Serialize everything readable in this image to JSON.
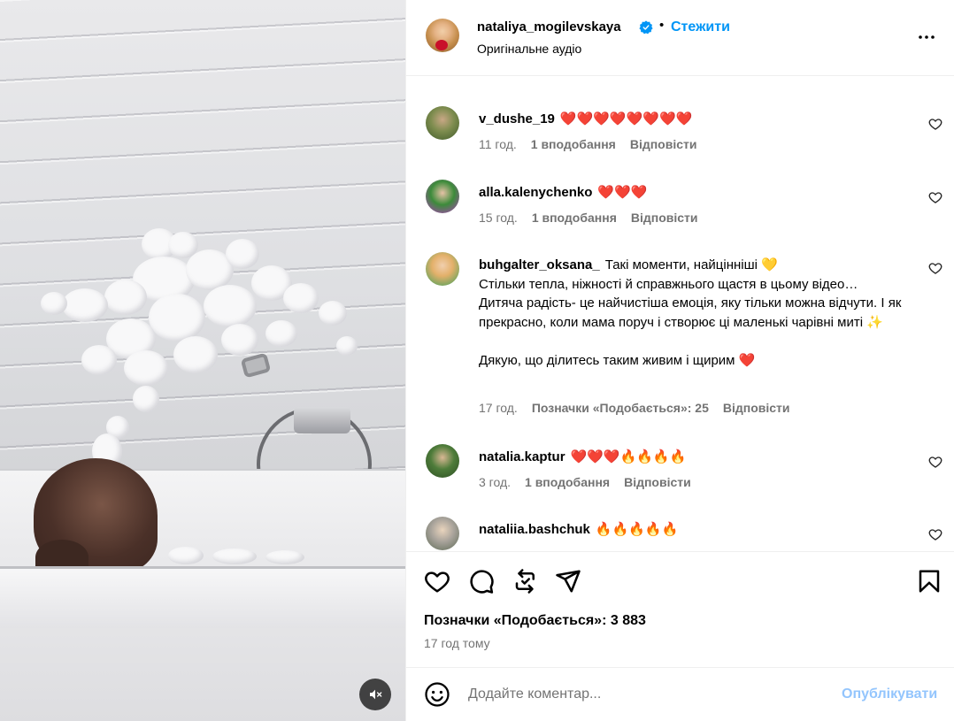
{
  "header": {
    "username": "nataliya_mogilevskaya",
    "separator": "•",
    "follow_label": "Стежити",
    "subtitle": "Оригінальне аудіо",
    "verified_icon": "verified-badge-icon",
    "more_icon": "more-horizontal-icon"
  },
  "comments": [
    {
      "user": "v_dushe_19",
      "text": "❤️❤️❤️❤️❤️❤️❤️❤️",
      "time": "11 год.",
      "likes": "1 вподобання",
      "reply": "Відповісти"
    },
    {
      "user": "alla.kalenychenko",
      "text": "❤️❤️❤️",
      "time": "15 год.",
      "likes": "1 вподобання",
      "reply": "Відповісти"
    },
    {
      "user": "buhgalter_oksana_",
      "text": "Такі моменти, найцінніші 💛",
      "text2": "Стільки тепла, ніжності й справжнього щастя в цьому відео… Дитяча радість- це найчистіша емоція, яку тільки можна відчути. І як прекрасно, коли мама поруч і створює ці маленькі чарівні миті ✨",
      "text3": "Дякую, що ділитесь таким живим і щирим ❤️",
      "time": "17 год.",
      "likes": "Позначки «Подобається»: 25",
      "reply": "Відповісти"
    },
    {
      "user": "natalia.kaptur",
      "text": "❤️❤️❤️🔥🔥🔥🔥",
      "time": "3 год.",
      "likes": "1 вподобання",
      "reply": "Відповісти"
    },
    {
      "user": "nataliia.bashchuk",
      "text": "🔥🔥🔥🔥🔥"
    }
  ],
  "actions": {
    "likes_label": "Позначки «Подобається»: 3 883",
    "time": "17 год тому",
    "icons": [
      "heart-icon",
      "comment-icon",
      "repost-icon",
      "share-icon",
      "bookmark-icon"
    ]
  },
  "composer": {
    "placeholder": "Додайте коментар...",
    "publish_label": "Опублікувати",
    "emoji_icon": "emoji-icon"
  },
  "media": {
    "mute_icon": "sound-off-icon"
  }
}
